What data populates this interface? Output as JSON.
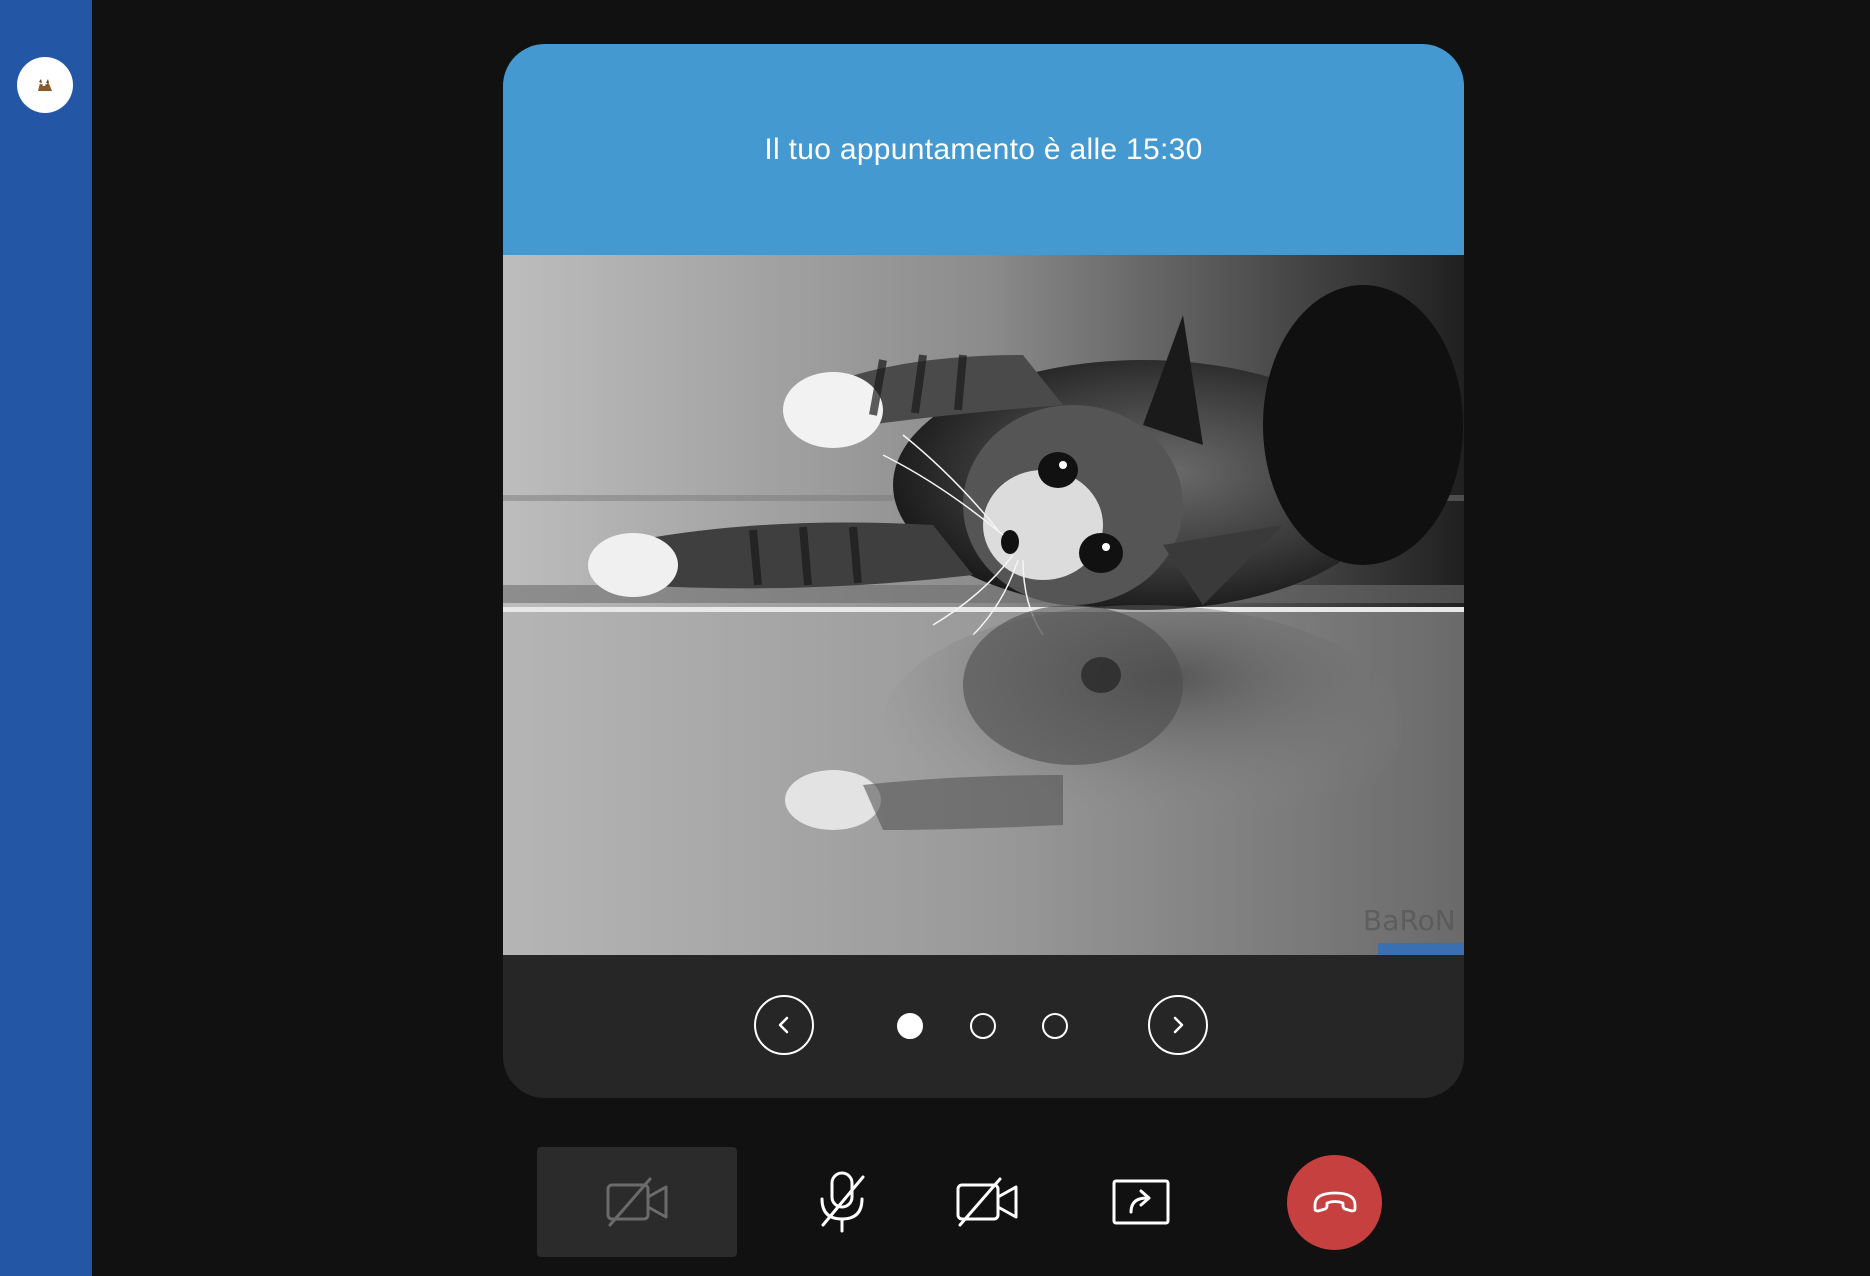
{
  "sidebar": {
    "avatar_icon": "cat-icon",
    "background": "#2456a6"
  },
  "card": {
    "title": "Il tuo appuntamento è alle 15:30",
    "header_color": "#4499d0",
    "image_description_icon": "kitten-photo",
    "watermark": "BaRoN",
    "carousel": {
      "prev_icon": "chevron-left-icon",
      "next_icon": "chevron-right-icon",
      "total_slides": 3,
      "active_index": 0
    }
  },
  "toolbar": {
    "camera_preview_icon": "video-off-icon",
    "mic_icon": "mic-off-icon",
    "video_icon": "video-off-icon",
    "share_icon": "share-screen-icon",
    "hangup_icon": "phone-hangup-icon",
    "hangup_color": "#c64040"
  }
}
